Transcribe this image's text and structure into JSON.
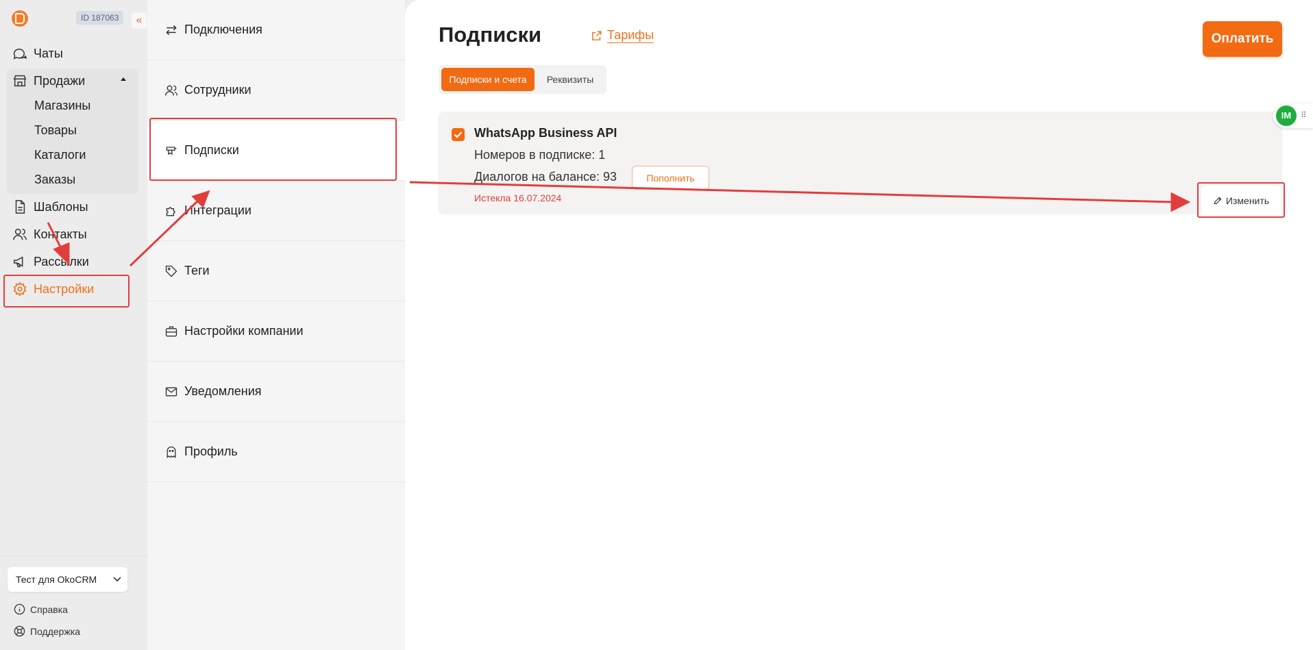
{
  "nav": {
    "account_id": "ID 187063",
    "collapse_glyph": "«",
    "items": {
      "chats": "Чаты",
      "sales": "Продажи",
      "templates": "Шаблоны",
      "contacts": "Контакты",
      "mailings": "Рассылки",
      "settings": "Настройки"
    },
    "sales_sub": [
      "Магазины",
      "Товары",
      "Каталоги",
      "Заказы"
    ],
    "company_select": "Тест для OkoCRM",
    "help": "Справка",
    "support": "Поддержка"
  },
  "settings_menu": [
    {
      "label": "Подключения",
      "icon": "arrows-exchange-icon"
    },
    {
      "label": "Сотрудники",
      "icon": "users-icon"
    },
    {
      "label": "Подписки",
      "icon": "subscriptions-icon"
    },
    {
      "label": "Интеграции",
      "icon": "puzzle-icon"
    },
    {
      "label": "Теги",
      "icon": "tag-icon"
    },
    {
      "label": "Настройки компании",
      "icon": "briefcase-icon"
    },
    {
      "label": "Уведомления",
      "icon": "mail-icon"
    },
    {
      "label": "Профиль",
      "icon": "ghost-icon"
    }
  ],
  "main": {
    "title": "Подписки",
    "tariffs_link": "Тарифы",
    "pay_button": "Оплатить",
    "tabs": [
      "Подписки и счета",
      "Реквизиты"
    ],
    "subscription": {
      "name": "WhatsApp Business API",
      "numbers": "Номеров в подписке: 1",
      "dialogs": "Диалогов на балансе: 93",
      "topup_button": "Пополнить",
      "status": "Истекла 16.07.2024",
      "edit_button": "Изменить"
    },
    "widget_label": "IM"
  },
  "colors": {
    "accent": "#f26a12",
    "annotation": "#e23d3d",
    "widget": "#1fad3e"
  }
}
